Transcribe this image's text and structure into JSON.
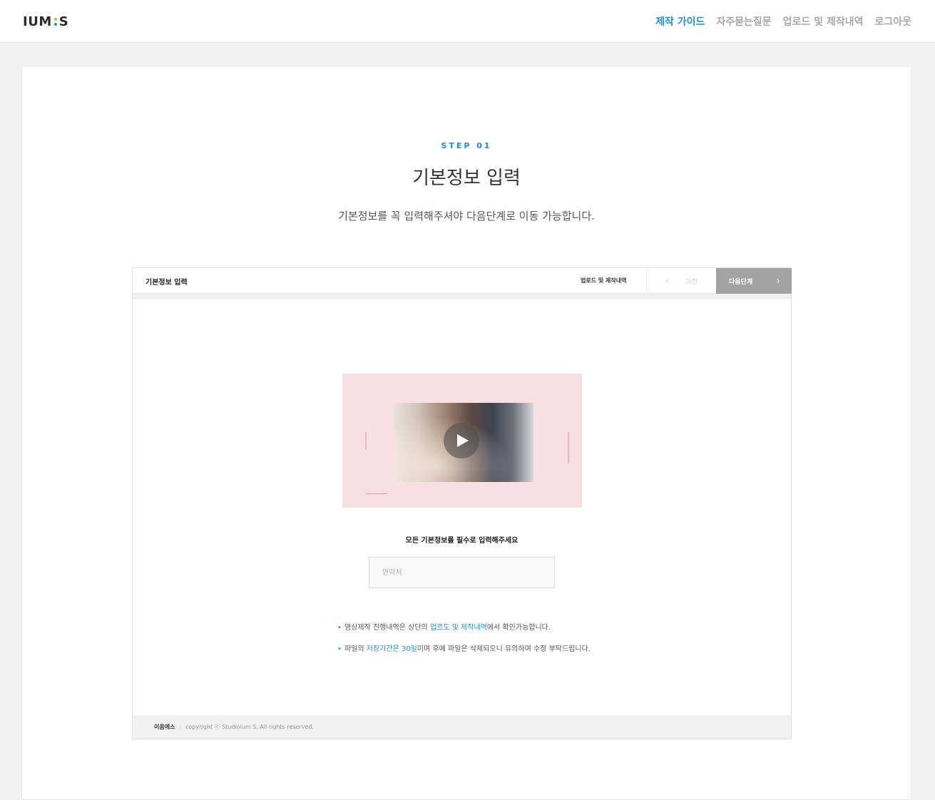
{
  "header": {
    "logo": {
      "left": "IUM",
      "right": "S"
    },
    "nav": [
      {
        "label": "제작 가이드",
        "active": true
      },
      {
        "label": "자주묻는질문",
        "active": false
      },
      {
        "label": "업로드 및 제작내역",
        "active": false
      },
      {
        "label": "로그아웃",
        "active": false
      }
    ]
  },
  "colors": {
    "accent": "#1a8fe3",
    "logo_dot_top": "#f5a623",
    "next_button": "#a3a3a3",
    "thumbnail_bg": "#f7dfe3"
  },
  "main": {
    "step": "STEP 01",
    "title": "기본정보 입력",
    "subtitle": "기본정보를 꼭 입력해주셔야 다음단계로 이동 가능합니다."
  },
  "preview": {
    "bar_title": "기본정보 입력",
    "upload_link": "업로드 및 제작내역",
    "prev_label": "이전",
    "next_label": "다음단계",
    "notice": "모든 기본정보를 필수로 입력해주세요",
    "phone_placeholder": "연락처",
    "bullets": [
      {
        "before": "영상제작 진행내역은 상단의 ",
        "highlight": "업르도 및 제작내역",
        "after": "에서 확인가능합니다."
      },
      {
        "before": "파일의 ",
        "highlight": "저장기간은 30일",
        "after": "이며 후에 파일은 삭제되오니 유의하여 수정 부탁드립니다."
      }
    ],
    "footer": {
      "brand": "이음에스",
      "sep": "|",
      "copyright": "copyright ⓒ Studioium S. All rights reserved."
    }
  }
}
